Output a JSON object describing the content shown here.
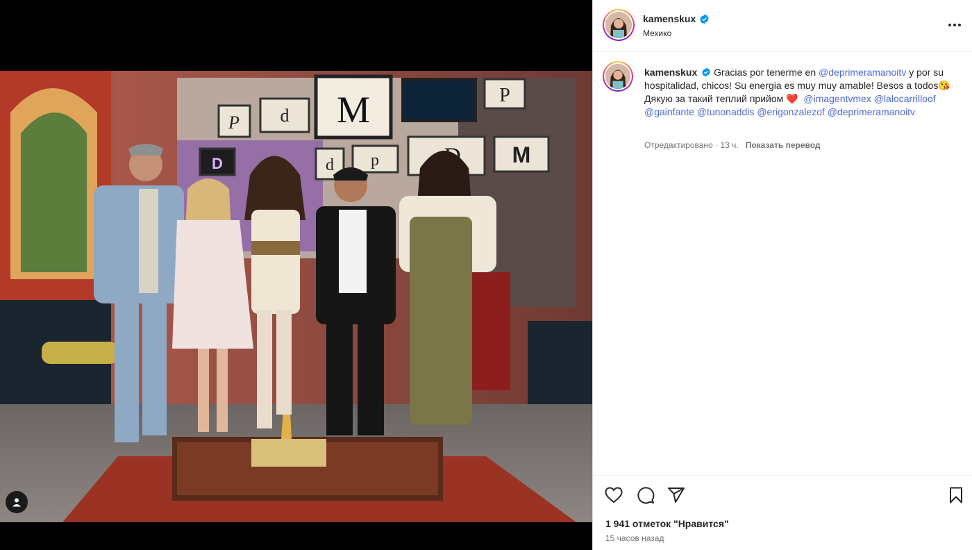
{
  "post": {
    "username": "kamenskux",
    "location": "Мехико",
    "caption": {
      "username": "kamenskux",
      "text_1": "Gracias por tenerme en",
      "mention_1": "@deprimeramanoitv",
      "text_2": "y por su hospitalidad, chicos! Su energia es muy muy amable! Besos a todos",
      "emoji_1": "😘",
      "text_3": "Дякую за такий теплий прийом",
      "emoji_2": "❤️",
      "mentions": [
        "@imagentvmex",
        "@lalocarrilloof",
        "@gainfante",
        "@tunonaddis",
        "@erigonzalezof",
        "@deprimeramanoitv"
      ]
    },
    "edited_label": "Отредактировано",
    "separator": "·",
    "caption_time": "13 ч.",
    "translate_label": "Показать перевод",
    "likes_text": "1 941 отметок \"Нравится\"",
    "time_ago": "15 часов назад"
  },
  "icons": {
    "verified": "verified-badge-icon",
    "more": "more-options-icon",
    "like": "heart-icon",
    "comment": "comment-icon",
    "share": "share-icon",
    "save": "bookmark-icon",
    "tag": "user-tag-icon"
  },
  "colors": {
    "verified": "#0095f6",
    "mention": "#4c68d7",
    "meta": "#737373",
    "text": "#262626"
  }
}
